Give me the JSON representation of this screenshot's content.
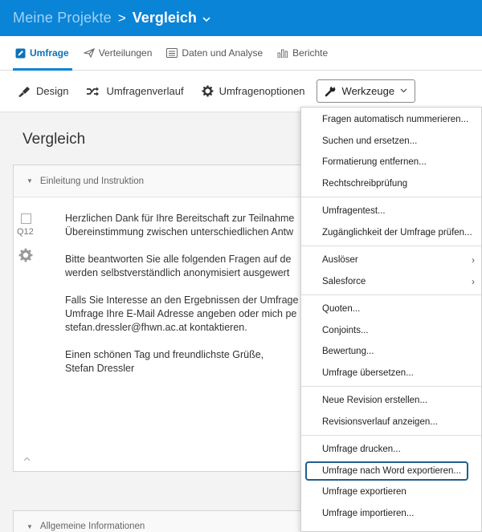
{
  "header": {
    "root": "Meine Projekte",
    "separator": ">",
    "current": "Vergleich",
    "chevron": "⌄"
  },
  "tabs": [
    {
      "label": "Umfrage",
      "icon": "pencil-icon",
      "active": true
    },
    {
      "label": "Verteilungen",
      "icon": "paper-plane-icon",
      "active": false
    },
    {
      "label": "Daten und Analyse",
      "icon": "data-table-icon",
      "active": false
    },
    {
      "label": "Berichte",
      "icon": "bar-chart-icon",
      "active": false
    }
  ],
  "toolbar": {
    "design": "Design",
    "history": "Umfragenverlauf",
    "options": "Umfragenoptionen",
    "tools": "Werkzeuge"
  },
  "page": {
    "title": "Vergleich"
  },
  "block1": {
    "title": "Einleitung und Instruktion",
    "question_id": "Q12",
    "paragraphs": [
      [
        "Herzlichen Dank für Ihre Bereitschaft zur Teilnahme",
        "Übereinstimmung zwischen unterschiedlichen Antw"
      ],
      [
        "Bitte beantworten Sie alle folgenden Fragen auf de",
        "werden selbstverständlich anonymisiert ausgewert"
      ],
      [
        "Falls Sie Interesse an den Ergebnissen der Umfrage",
        "Umfrage Ihre E-Mail Adresse angeben oder mich pe",
        "stefan.dressler@fhwn.ac.at kontaktieren."
      ],
      [
        "Einen schönen Tag und freundlichste Grüße,",
        "Stefan Dressler"
      ]
    ]
  },
  "block2": {
    "title": "Allgemeine Informationen"
  },
  "menu": {
    "groups": [
      [
        {
          "label": "Fragen automatisch nummerieren..."
        },
        {
          "label": "Suchen und ersetzen..."
        },
        {
          "label": "Formatierung entfernen..."
        },
        {
          "label": "Rechtschreibprüfung"
        }
      ],
      [
        {
          "label": "Umfragentest..."
        },
        {
          "label": "Zugänglichkeit der Umfrage prüfen..."
        }
      ],
      [
        {
          "label": "Auslöser",
          "submenu": true
        },
        {
          "label": "Salesforce",
          "submenu": true
        }
      ],
      [
        {
          "label": "Quoten..."
        },
        {
          "label": "Conjoints..."
        },
        {
          "label": "Bewertung..."
        },
        {
          "label": "Umfrage übersetzen..."
        }
      ],
      [
        {
          "label": "Neue Revision erstellen..."
        },
        {
          "label": "Revisionsverlauf anzeigen..."
        }
      ],
      [
        {
          "label": "Umfrage drucken..."
        },
        {
          "label": "Umfrage nach Word exportieren...",
          "focused": true
        },
        {
          "label": "Umfrage exportieren"
        },
        {
          "label": "Umfrage importieren..."
        }
      ]
    ]
  },
  "colors": {
    "topbar": "#0a84d6",
    "accent": "#0a72b8",
    "focus_ring": "#1e5f8e"
  }
}
